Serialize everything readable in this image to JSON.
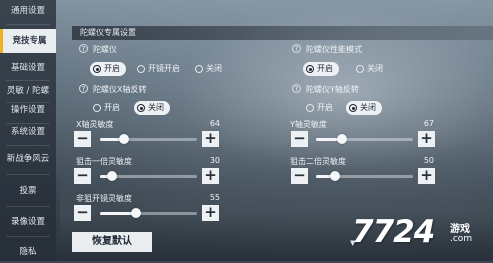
{
  "sidebar": {
    "items": [
      {
        "label": "通用设置",
        "active": false
      },
      {
        "label": "竞技专属",
        "active": true
      },
      {
        "label": "基础设置",
        "active": false
      },
      {
        "label": "灵敏 / 陀螺",
        "active": false
      },
      {
        "label": "操作设置",
        "active": false
      },
      {
        "label": "系统设置",
        "active": false
      },
      {
        "label": "新战争风云",
        "active": false
      },
      {
        "label": "投票",
        "active": false
      },
      {
        "label": "录像设置",
        "active": false
      },
      {
        "label": "隐私",
        "active": false
      }
    ]
  },
  "panel": {
    "title": "陀螺仪专属设置",
    "gyro": {
      "label": "陀螺仪",
      "options": [
        "开启",
        "开镜开启",
        "关闭"
      ],
      "selected": "开启"
    },
    "gyro_mode": {
      "label": "陀螺仪性能模式",
      "options": [
        "开启",
        "关闭"
      ],
      "selected": "开启"
    },
    "gyro_x_invert": {
      "label": "陀螺仪X轴反转",
      "options": [
        "开启",
        "关闭"
      ],
      "selected": "关闭"
    },
    "gyro_y_invert": {
      "label": "陀螺仪Y轴反转",
      "options": [
        "开启",
        "关闭"
      ],
      "selected": "关闭"
    },
    "sliders": {
      "x_sens": {
        "label": "X轴灵敏度",
        "value": "64",
        "fraction": 0.25
      },
      "y_sens": {
        "label": "Y轴灵敏度",
        "value": "67",
        "fraction": 0.27
      },
      "sniper1": {
        "label": "狙击一倍灵敏度",
        "value": "30",
        "fraction": 0.12
      },
      "sniper2": {
        "label": "狙击二倍灵敏度",
        "value": "50",
        "fraction": 0.2
      },
      "no_scope": {
        "label": "非狙开镜灵敏度",
        "value": "55",
        "fraction": 0.37
      }
    },
    "reset_label": "恢复默认"
  },
  "watermark": {
    "number": "7724",
    "text": "游戏",
    "url": ".com"
  },
  "colors": {
    "accent": "#f2b01e",
    "active_bg": "#e9edf0"
  }
}
